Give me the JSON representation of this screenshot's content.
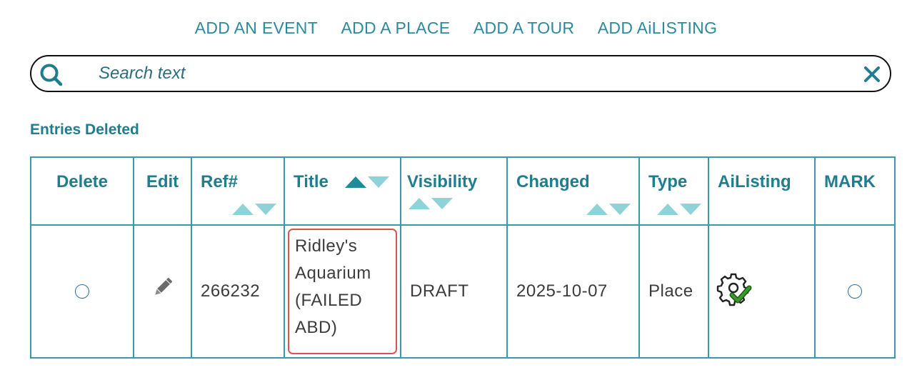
{
  "nav": {
    "items": [
      {
        "label": "ADD AN EVENT"
      },
      {
        "label": "ADD A PLACE"
      },
      {
        "label": "ADD A TOUR"
      },
      {
        "label": "ADD AiLISTING"
      }
    ]
  },
  "search": {
    "placeholder": "Search text",
    "value": "",
    "search_icon": "search-icon",
    "clear_icon": "close-icon"
  },
  "section": {
    "title": "Entries Deleted"
  },
  "table": {
    "columns": [
      {
        "label": "Delete",
        "sortable": false
      },
      {
        "label": "Edit",
        "sortable": false
      },
      {
        "label": "Ref#",
        "sortable": true
      },
      {
        "label": "Title",
        "sortable": true,
        "sort_active": "ascending"
      },
      {
        "label": "Visibility",
        "sortable": true
      },
      {
        "label": "Changed",
        "sortable": true
      },
      {
        "label": "Type",
        "sortable": true
      },
      {
        "label": "AiListing",
        "sortable": false
      },
      {
        "label": "MARK",
        "sortable": false
      }
    ],
    "rows": [
      {
        "delete_checked": false,
        "edit_icon": "pencil-icon",
        "ref": "266232",
        "title": "Ridley's Aquarium (FAILED ABD)",
        "title_lines": [
          "Ridley's",
          "Aquarium",
          "(FAILED",
          "ABD)"
        ],
        "visibility": "DRAFT",
        "changed": "2025-10-07",
        "type": "Place",
        "ailisting_icon": "gear-check-icon",
        "mark_checked": false
      }
    ]
  },
  "colors": {
    "accent": "#2b8a9b",
    "heading": "#1f7d8e",
    "border": "#3a9aab",
    "sort_inactive": "#8fd3d8",
    "sort_active": "#1f8a9c",
    "highlight": "#d9534f",
    "check": "#3a9a2e"
  }
}
